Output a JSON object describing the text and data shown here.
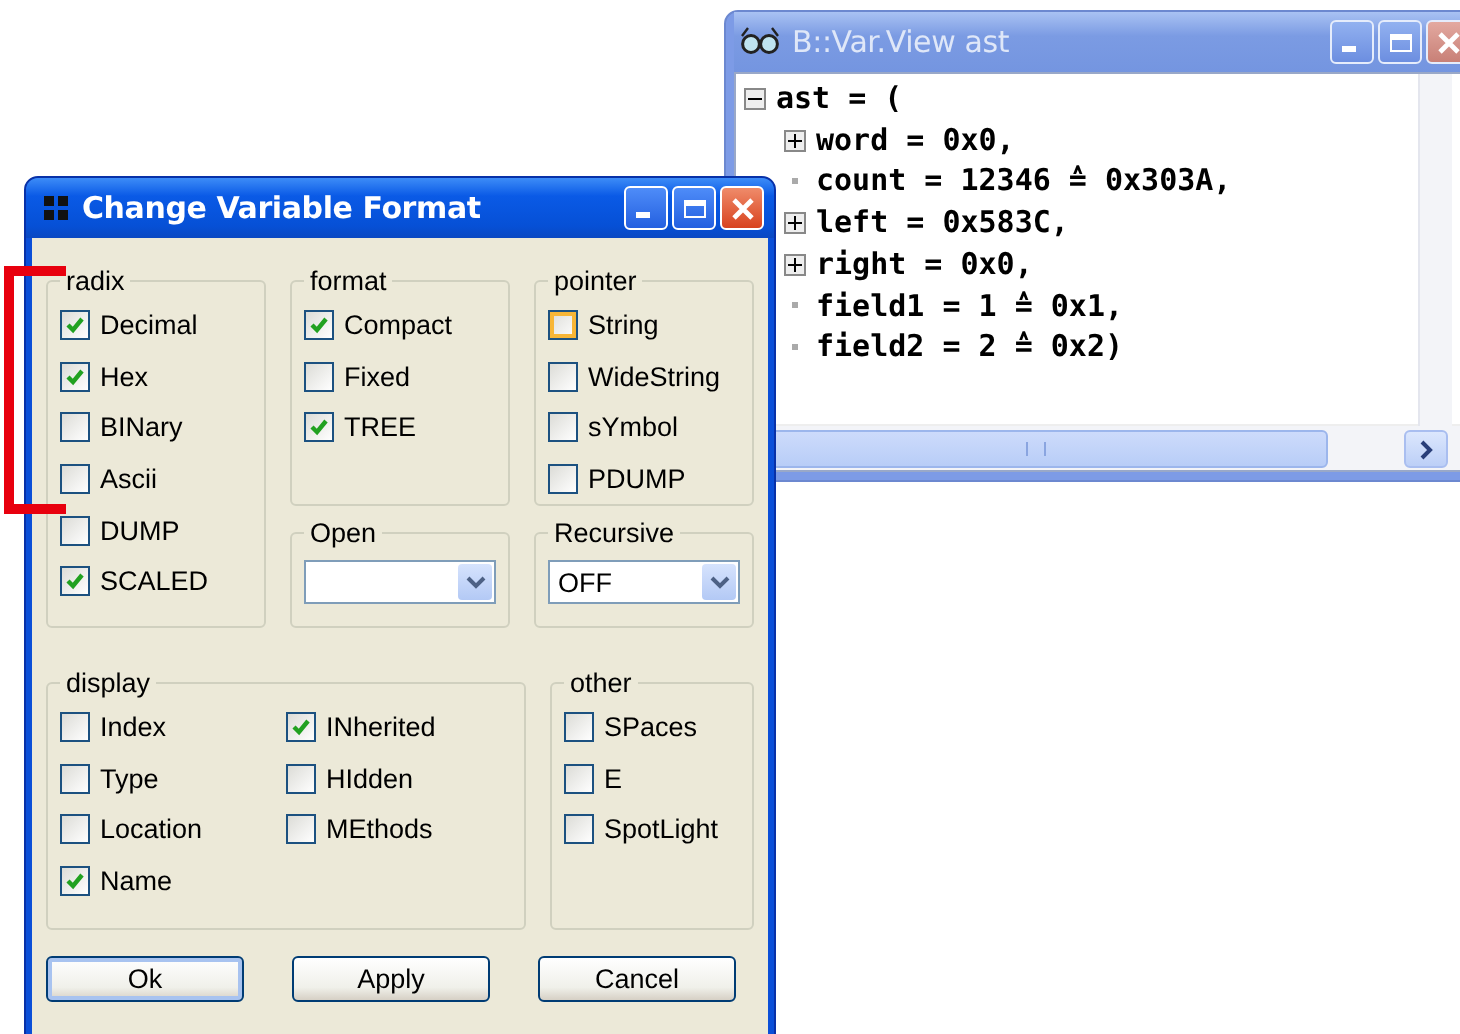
{
  "var_view": {
    "title": "B::Var.View ast",
    "tree": [
      {
        "text": "ast = (",
        "kind": "expanded",
        "children": [
          {
            "text": "word = 0x0,",
            "kind": "collapsed"
          },
          {
            "text": "count = 12346 ≙ 0x303A,",
            "kind": "leaf"
          },
          {
            "text": "left = 0x583C,",
            "kind": "collapsed"
          },
          {
            "text": "right = 0x0,",
            "kind": "collapsed"
          },
          {
            "text": "field1 = 1 ≙ 0x1,",
            "kind": "leaf"
          },
          {
            "text": "field2 = 2 ≙ 0x2)",
            "kind": "leaf"
          }
        ]
      }
    ]
  },
  "dialog": {
    "title": "Change Variable Format",
    "radix": {
      "label": "radix",
      "items": [
        {
          "label": "Decimal",
          "checked": true,
          "hover": false
        },
        {
          "label": "Hex",
          "checked": true,
          "hover": false
        },
        {
          "label": "BINary",
          "checked": false,
          "hover": false
        },
        {
          "label": "Ascii",
          "checked": false,
          "hover": false
        },
        {
          "label": "DUMP",
          "checked": false,
          "hover": false
        },
        {
          "label": "SCALED",
          "checked": true,
          "hover": false
        }
      ]
    },
    "format": {
      "label": "format",
      "items": [
        {
          "label": "Compact",
          "checked": true,
          "hover": false
        },
        {
          "label": "Fixed",
          "checked": false,
          "hover": false
        },
        {
          "label": "TREE",
          "checked": true,
          "hover": false
        }
      ]
    },
    "open": {
      "label": "Open"
    },
    "pointer": {
      "label": "pointer",
      "items": [
        {
          "label": "String",
          "checked": false,
          "hover": true
        },
        {
          "label": "WideString",
          "checked": false,
          "hover": false
        },
        {
          "label": "sYmbol",
          "checked": false,
          "hover": false
        },
        {
          "label": "PDUMP",
          "checked": false,
          "hover": false
        }
      ]
    },
    "recursive": {
      "label": "Recursive",
      "value": "OFF"
    },
    "display": {
      "label": "display",
      "columns": [
        [
          {
            "label": "Index",
            "checked": false,
            "hover": false
          },
          {
            "label": "Type",
            "checked": false,
            "hover": false
          },
          {
            "label": "Location",
            "checked": false,
            "hover": false
          },
          {
            "label": "Name",
            "checked": true,
            "hover": false
          }
        ],
        [
          {
            "label": "INherited",
            "checked": true,
            "hover": false
          },
          {
            "label": "HIdden",
            "checked": false,
            "hover": false
          },
          {
            "label": "MEthods",
            "checked": false,
            "hover": false
          }
        ]
      ]
    },
    "other": {
      "label": "other",
      "items": [
        {
          "label": "SPaces",
          "checked": false,
          "hover": false
        },
        {
          "label": "E",
          "checked": false,
          "hover": false
        },
        {
          "label": "SpotLight",
          "checked": false,
          "hover": false
        }
      ]
    },
    "buttons": [
      "Ok",
      "Apply",
      "Cancel"
    ]
  }
}
